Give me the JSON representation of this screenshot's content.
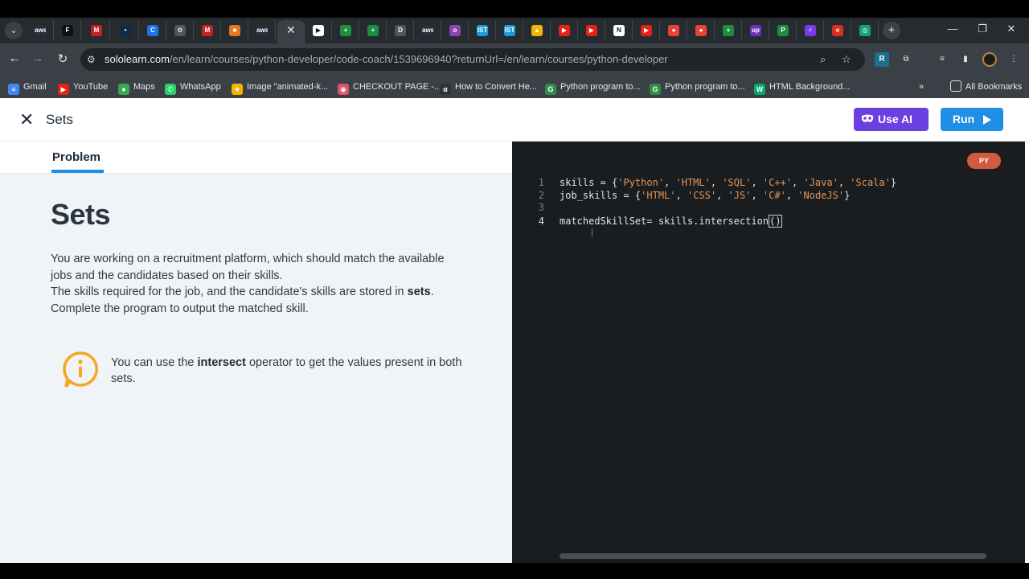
{
  "tabs": [
    {
      "icon": "aws-icon",
      "glyph": "aws",
      "color": "#232f3e"
    },
    {
      "icon": "dark-icon",
      "glyph": "F",
      "color": "#111"
    },
    {
      "icon": "gmail-icon",
      "glyph": "M",
      "color": "#c5221f"
    },
    {
      "icon": "dot-icon",
      "glyph": "•",
      "color": "#0d2c45"
    },
    {
      "icon": "circle-c-icon",
      "glyph": "C",
      "color": "#1a73e8"
    },
    {
      "icon": "robot-icon",
      "glyph": "⚙",
      "color": "#555"
    },
    {
      "icon": "gmail-icon",
      "glyph": "M",
      "color": "#c5221f"
    },
    {
      "icon": "box-icon",
      "glyph": "■",
      "color": "#e8761e"
    },
    {
      "icon": "aws-icon",
      "glyph": "aws",
      "color": "#232f3e"
    },
    {
      "icon": "close-icon",
      "glyph": "✕",
      "color": "transparent",
      "active": true
    },
    {
      "icon": "sololearn-icon",
      "glyph": "▶",
      "color": "#fff"
    },
    {
      "icon": "sheets-icon",
      "glyph": "+",
      "color": "#1e8e3e"
    },
    {
      "icon": "sheets-icon",
      "glyph": "+",
      "color": "#1e8e3e"
    },
    {
      "icon": "doc-d-icon",
      "glyph": "D",
      "color": "#555"
    },
    {
      "icon": "aws-icon",
      "glyph": "aws",
      "color": "#232f3e"
    },
    {
      "icon": "purple-icon",
      "glyph": "o",
      "color": "#8e44ad"
    },
    {
      "icon": "ist-icon",
      "glyph": "IST",
      "color": "#1a9bd7"
    },
    {
      "icon": "ist-icon",
      "glyph": "IST",
      "color": "#1a9bd7"
    },
    {
      "icon": "drive-icon",
      "glyph": "▲",
      "color": "#f4b400"
    },
    {
      "icon": "youtube-icon",
      "glyph": "▶",
      "color": "#e62117"
    },
    {
      "icon": "youtube-icon",
      "glyph": "▶",
      "color": "#e62117"
    },
    {
      "icon": "notion-icon",
      "glyph": "N",
      "color": "#fff"
    },
    {
      "icon": "youtube-icon",
      "glyph": "▶",
      "color": "#e62117"
    },
    {
      "icon": "maps-icon",
      "glyph": "●",
      "color": "#ea4335"
    },
    {
      "icon": "maps-icon",
      "glyph": "●",
      "color": "#ea4335"
    },
    {
      "icon": "sheets-icon",
      "glyph": "+",
      "color": "#1e8e3e"
    },
    {
      "icon": "upwork-icon",
      "glyph": "up",
      "color": "#6d2fbd"
    },
    {
      "icon": "flag-icon",
      "glyph": "P",
      "color": "#1e8e3e"
    },
    {
      "icon": "bolt-icon",
      "glyph": "⚡",
      "color": "#7c3aed"
    },
    {
      "icon": "e-icon",
      "glyph": "e",
      "color": "#d93025"
    },
    {
      "icon": "chatgpt-icon",
      "glyph": "◎",
      "color": "#10a37f"
    }
  ],
  "address": {
    "host": "sololearn.com",
    "path": "/en/learn/courses/python-developer/code-coach/1539696940?returnUrl=/en/learn/courses/python-developer"
  },
  "bookmarks": [
    {
      "label": "Gmail",
      "icon": "gmail-icon",
      "color": "#4285f4",
      "glyph": "≡"
    },
    {
      "label": "YouTube",
      "icon": "youtube-icon",
      "color": "#e62117",
      "glyph": "▶"
    },
    {
      "label": "Maps",
      "icon": "maps-icon",
      "color": "#34a853",
      "glyph": "●"
    },
    {
      "label": "WhatsApp",
      "icon": "whatsapp-icon",
      "color": "#25d366",
      "glyph": "✆"
    },
    {
      "label": "Image \"animated-k...",
      "icon": "star-icon",
      "color": "#f4b400",
      "glyph": "★"
    },
    {
      "label": "CHECKOUT PAGE -...",
      "icon": "lips-icon",
      "color": "#e0506a",
      "glyph": "◉"
    },
    {
      "label": "How to Convert He...",
      "icon": "alpha-icon",
      "color": "#333",
      "glyph": "α"
    },
    {
      "label": "Python program to...",
      "icon": "gfg-icon",
      "color": "#2f8d46",
      "glyph": "G"
    },
    {
      "label": "Python program to...",
      "icon": "gfg-icon",
      "color": "#2f8d46",
      "glyph": "G"
    },
    {
      "label": "HTML Background...",
      "icon": "w3-icon",
      "color": "#04aa6d",
      "glyph": "W"
    }
  ],
  "bookmarks_all": "All Bookmarks",
  "header": {
    "title": "Sets",
    "use_ai": "Use AI",
    "run": "Run"
  },
  "problem": {
    "tab": "Problem",
    "heading": "Sets",
    "p1": "You are working on a recruitment platform, which should match the available jobs and the candidates based on their skills.",
    "p2a": "The skills required for the job, and the candidate's skills are stored in ",
    "p2b": "sets",
    "p2c": ".",
    "p3": "Complete the program to output the matched skill.",
    "hint_a": "You can use the ",
    "hint_b": "intersect",
    "hint_c": " operator to get the values present in both sets."
  },
  "editor": {
    "lang": "PY",
    "lines": [
      {
        "n": "1",
        "parts": [
          [
            "n",
            "skills = {"
          ],
          [
            "s",
            "'Python'"
          ],
          [
            "p",
            ", "
          ],
          [
            "s",
            "'HTML'"
          ],
          [
            "p",
            ", "
          ],
          [
            "s",
            "'SQL'"
          ],
          [
            "p",
            ", "
          ],
          [
            "s",
            "'C++'"
          ],
          [
            "p",
            ", "
          ],
          [
            "s",
            "'Java'"
          ],
          [
            "p",
            ", "
          ],
          [
            "s",
            "'Scala'"
          ],
          [
            "p",
            "}"
          ]
        ]
      },
      {
        "n": "2",
        "parts": [
          [
            "n",
            "job_skills = {"
          ],
          [
            "s",
            "'HTML'"
          ],
          [
            "p",
            ", "
          ],
          [
            "s",
            "'CSS'"
          ],
          [
            "p",
            ", "
          ],
          [
            "s",
            "'JS'"
          ],
          [
            "p",
            ", "
          ],
          [
            "s",
            "'C#'"
          ],
          [
            "p",
            ", "
          ],
          [
            "s",
            "'NodeJS'"
          ],
          [
            "p",
            "}"
          ]
        ]
      },
      {
        "n": "3",
        "parts": []
      },
      {
        "n": "4",
        "parts": [
          [
            "n",
            "matchedSkillSet= skills.intersection"
          ],
          [
            "c",
            "()"
          ]
        ]
      }
    ]
  }
}
